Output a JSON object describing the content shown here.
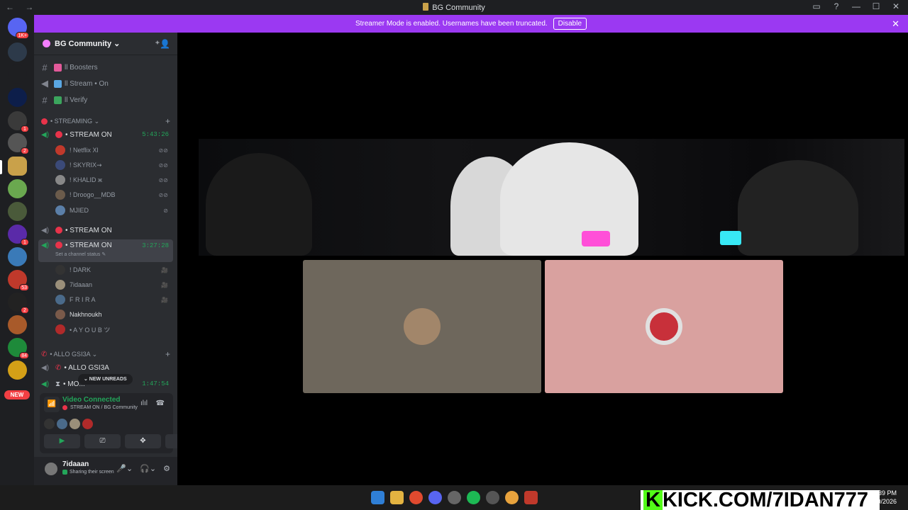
{
  "titlebar": {
    "nav": "← →",
    "title": "BG Community",
    "icons": [
      "inbox-icon",
      "help-icon",
      "minimize-icon",
      "maximize-icon",
      "close-icon"
    ],
    "glyphs": [
      "▭",
      "?",
      "—",
      "☐",
      "✕"
    ]
  },
  "banner": {
    "text": "Streamer Mode is enabled. Usernames have been truncated.",
    "button": "Disable",
    "close": "✕"
  },
  "servers": {
    "badges": [
      "1K+",
      "1",
      "2",
      "1",
      "53",
      "2",
      "84"
    ],
    "new_label": "NEW"
  },
  "guild": {
    "name": "BG Community ⌄",
    "add_icon": "person-add-icon",
    "add_glyph": "⁺👤"
  },
  "channels": [
    {
      "label": "ll Boosters",
      "emoji_color": "#e35a9a"
    },
    {
      "label": "ll Stream • On",
      "emoji_color": "#5aa7e3"
    },
    {
      "label": "ll Verify",
      "emoji_color": "#3ba55d"
    }
  ],
  "streaming": {
    "category": "• STREAMING ⌄",
    "voice1": {
      "label": "• STREAM ON",
      "time": "5:43:26"
    },
    "users1": [
      {
        "name": "! Netflix Xl",
        "color": "#c0392b"
      },
      {
        "name": "! SKYRIX⇝",
        "color": "#3b4a78"
      },
      {
        "name": "! KHALID ж",
        "color": "#888888"
      },
      {
        "name": "! Droogo__MDB",
        "color": "#6b5b4b"
      },
      {
        "name": "MJIED",
        "color": "#5b7fa8"
      }
    ],
    "voice2": {
      "label": "• STREAM ON"
    },
    "voice3": {
      "label": "• STREAM ON",
      "time": "3:27:28",
      "status": "Set a channel status ✎"
    },
    "users3": [
      {
        "name": "! DARK",
        "color": "#333333"
      },
      {
        "name": "7idaaan",
        "color": "#9a8f7a"
      },
      {
        "name": "F R I R A",
        "color": "#4a6a8a"
      },
      {
        "name": "Nakhnoukh",
        "color": "#7a5a4a"
      },
      {
        "name": "• A Y O U B ツ",
        "color": "#b02a2a"
      }
    ],
    "user_icons": [
      "🎥",
      "🎥",
      "🎥"
    ]
  },
  "allo": {
    "category": "• ALLO GSI3A ⌄",
    "voice": "• ALLO GSI3A",
    "voice2": "• MO...",
    "time": "1:47:54"
  },
  "new_unreads": "⌄ NEW UNREADS",
  "voice_panel": {
    "title": "Video Connected",
    "subtitle": "STREAM ON / BG Community",
    "signal_glyph": "📶",
    "noise_glyph": "ılıl",
    "disconnect_glyph": "☎",
    "buttons": [
      "▶",
      "⎚",
      "✥",
      "🚀"
    ]
  },
  "userbar": {
    "name": "7idaaan",
    "status": "Sharing their screen",
    "controls": [
      "🎤⌄",
      "🎧⌄",
      "⚙"
    ]
  },
  "stage": {
    "tile_colors": [
      "#6e675c",
      "#d9a19f"
    ]
  },
  "overlay": {
    "kick_k": "K",
    "kick_text": "KICK.COM/7IDAN777"
  },
  "taskbar": {
    "clock_time": "1:39 PM",
    "clock_date": "0/2026",
    "icon_colors": [
      "#2f7fd6",
      "#e3b341",
      "#e04a2f",
      "#5865f2",
      "#666666",
      "#1db954",
      "#555555",
      "#e8a33d",
      "#c0392b"
    ]
  }
}
